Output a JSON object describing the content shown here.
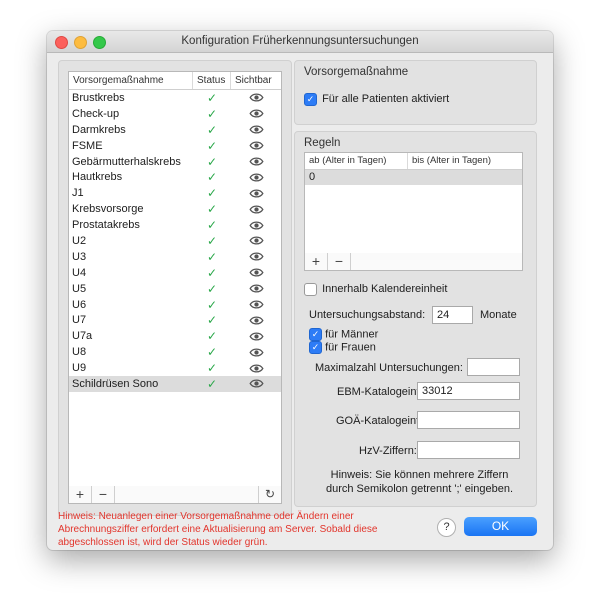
{
  "window": {
    "title": "Konfiguration Früherkennungsuntersuchungen"
  },
  "list": {
    "col_name": "Vorsorgemaßnahme",
    "col_status": "Status",
    "col_visible": "Sichtbar",
    "status_symbol": "✓",
    "status_color": "#2ba84a",
    "items": [
      {
        "name": "Brustkrebs"
      },
      {
        "name": "Check-up"
      },
      {
        "name": "Darmkrebs"
      },
      {
        "name": "FSME"
      },
      {
        "name": "Gebärmutterhalskrebs"
      },
      {
        "name": "Hautkrebs"
      },
      {
        "name": "J1"
      },
      {
        "name": "Krebsvorsorge"
      },
      {
        "name": "Prostatakrebs"
      },
      {
        "name": "U2"
      },
      {
        "name": "U3"
      },
      {
        "name": "U4"
      },
      {
        "name": "U5"
      },
      {
        "name": "U6"
      },
      {
        "name": "U7"
      },
      {
        "name": "U7a"
      },
      {
        "name": "U8"
      },
      {
        "name": "U9"
      },
      {
        "name": "Schildrüsen Sono",
        "selected": true
      }
    ],
    "add_label": "+",
    "remove_label": "−",
    "refresh_label": "↻"
  },
  "measure": {
    "title": "Vorsorgemaßnahme",
    "all_patients_label": "Für alle Patienten aktiviert",
    "all_patients_checked": true
  },
  "rules": {
    "title": "Regeln",
    "col_from": "ab (Alter in Tagen)",
    "col_to": "bis (Alter in Tagen)",
    "rows": [
      {
        "from": "0",
        "to": ""
      }
    ],
    "add_label": "+",
    "remove_label": "−",
    "calendar_unit_label": "Innerhalb Kalendereinheit",
    "calendar_unit_checked": false,
    "interval_label": "Untersuchungsabstand:",
    "interval_value": "24",
    "interval_unit": "Monate",
    "male_label": "für Männer",
    "male_checked": true,
    "female_label": "für Frauen",
    "female_checked": true,
    "max_label": "Maximalzahl Untersuchungen:",
    "max_value": "",
    "ebm_label": "EBM-Katalogeintrag:",
    "ebm_value": "33012",
    "goae_label": "GOÄ-Katalogeintrag:",
    "goae_value": "",
    "hzv_label": "HzV-Ziffern:",
    "hzv_value": "",
    "note": "Hinweis: Sie können mehrere Ziffern durch Semikolon getrennt ';' eingeben."
  },
  "footer": {
    "hint": "Hinweis: Neuanlegen einer Vorsorgemaßnahme oder Ändern einer Abrechnungsziffer erfordert eine Aktualisierung am Server. Sobald diese abgeschlossen ist, wird der Status wieder grün.",
    "hint_color": "#e2352c",
    "help_label": "?",
    "ok_label": "OK",
    "ok_color": "#1a74f3"
  }
}
